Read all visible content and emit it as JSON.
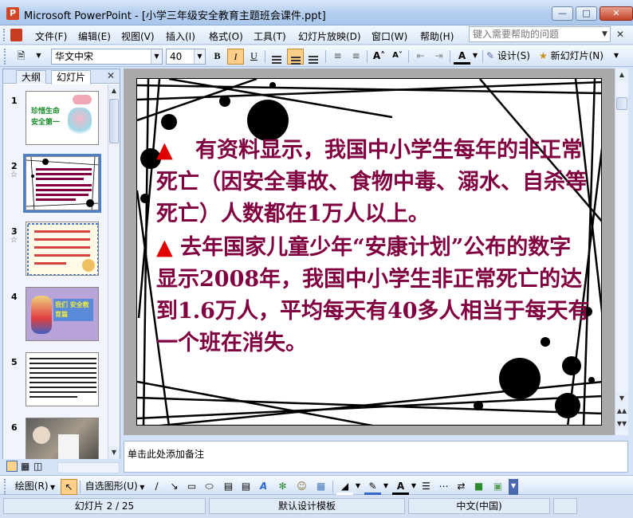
{
  "window": {
    "title": "Microsoft PowerPoint - [小学三年级安全教育主题班会课件.ppt]",
    "minimize_icon": "minimize-icon",
    "maximize_icon": "maximize-icon",
    "close_icon": "close-icon"
  },
  "menubar": {
    "items": [
      "文件(F)",
      "编辑(E)",
      "视图(V)",
      "插入(I)",
      "格式(O)",
      "工具(T)",
      "幻灯片放映(D)",
      "窗口(W)",
      "帮助(H)"
    ],
    "help_placeholder": "键入需要帮助的问题"
  },
  "format_toolbar": {
    "font_name": "华文中宋",
    "font_size": "40",
    "bold": "B",
    "italic": "I",
    "underline": "U",
    "grow_font": "A˄",
    "shrink_font": "A˅",
    "design_label": "设计(S)",
    "new_slide_label": "新幻灯片(N)",
    "font_color": "A"
  },
  "left_panel": {
    "tabs": [
      "大纲",
      "幻灯片"
    ],
    "active_tab": "幻灯片",
    "slides": [
      {
        "number": "1",
        "title": "珍惜生命 安全第一"
      },
      {
        "number": "2",
        "selected": true
      },
      {
        "number": "3"
      },
      {
        "number": "4",
        "title": "我们 安全教育篇"
      },
      {
        "number": "5"
      },
      {
        "number": "6"
      }
    ]
  },
  "slide": {
    "paragraphs": [
      "▲ 有资料显示，我国中小学生每年的非正常死亡（因安全事故、食物中毒、溺水、自杀等死亡）人数都在1万人以上。",
      "▲ 去年国家儿童少年“安康计划”公布的数字显示2008年，我国中小学生非正常死亡的达到1.6万人，平均每天有40多人相当于每天有一个班在消失。"
    ],
    "bullet": "▲",
    "p1": "有资料显示，我国中小学生每年的非正常死亡（因安全事故、食物中毒、溺水、自杀等死亡）人数都在1万人以上。",
    "p2": "去年国家儿童少年“安康计划”公布的数字显示2008年，我国中小学生非正常死亡的达到1.6万人，平均每天有40多人相当于每天有一个班在消失。",
    "text_color": "#800040",
    "bullet_color": "#e00000"
  },
  "notes": {
    "placeholder": "单击此处添加备注"
  },
  "draw_toolbar": {
    "draw_label": "绘图(R)",
    "autoshapes_label": "自选图形(U)"
  },
  "statusbar": {
    "slide_position": "幻灯片 2 / 25",
    "template": "默认设计模板",
    "language": "中文(中国)"
  }
}
